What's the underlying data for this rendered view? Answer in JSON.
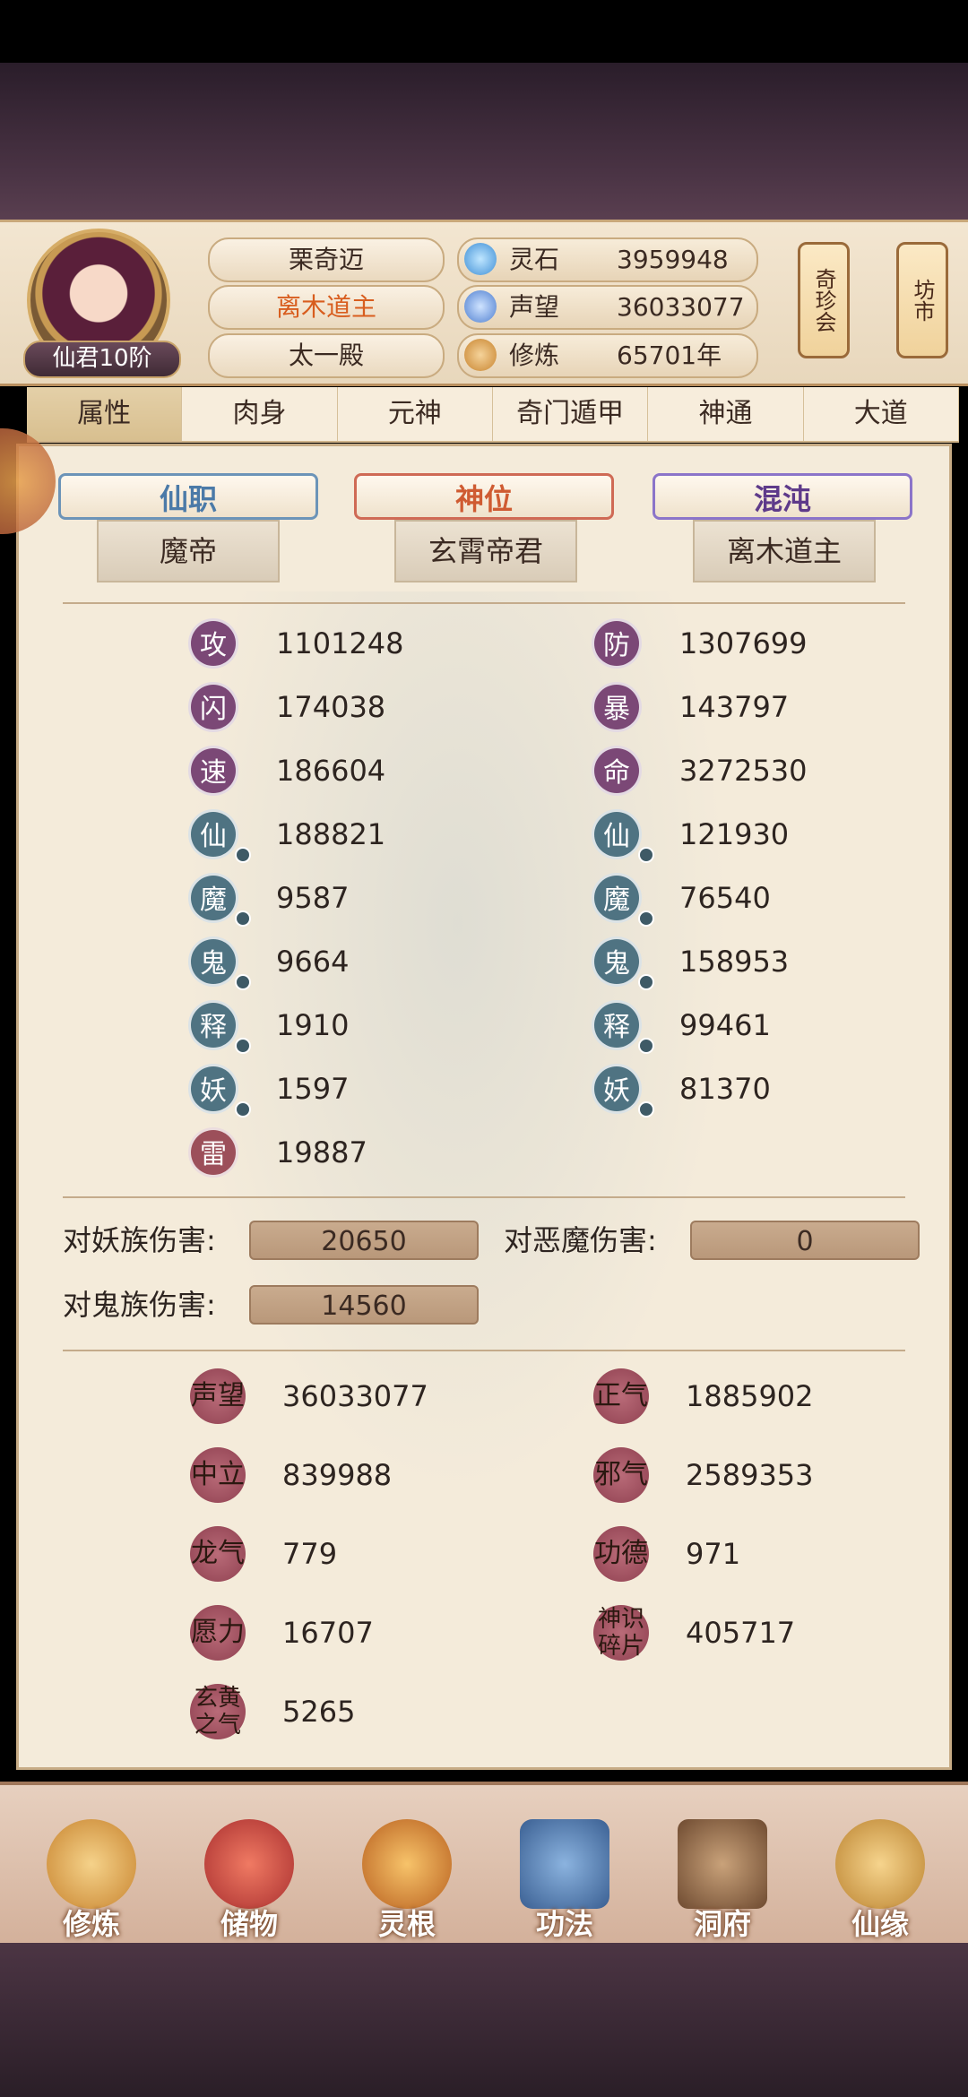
{
  "header": {
    "rank": "仙君10阶",
    "names": [
      "栗奇迈",
      "离木道主",
      "太一殿"
    ],
    "resources": [
      {
        "label": "灵石",
        "value": "3959948",
        "icon": "spirit-stone-icon",
        "color": "#4da6e8"
      },
      {
        "label": "声望",
        "value": "36033077",
        "icon": "reputation-icon",
        "color": "#4f8fd9"
      },
      {
        "label": "修炼",
        "value": "65701年",
        "icon": "meditation-icon",
        "color": "#d7953d"
      }
    ],
    "side_buttons": [
      {
        "label": "奇珍会"
      },
      {
        "label": "坊市"
      }
    ]
  },
  "tabs": [
    "属性",
    "肉身",
    "元神",
    "奇门遁甲",
    "神通",
    "大道"
  ],
  "titles": [
    {
      "banner": "仙职",
      "value": "魔帝"
    },
    {
      "banner": "神位",
      "value": "玄霄帝君"
    },
    {
      "banner": "混沌",
      "value": "离木道主"
    }
  ],
  "stats_left": [
    {
      "glyph": "攻",
      "value": "1101248",
      "color": "purple"
    },
    {
      "glyph": "闪",
      "value": "174038",
      "color": "purple"
    },
    {
      "glyph": "速",
      "value": "186604",
      "color": "purple"
    },
    {
      "glyph": "仙",
      "value": "188821",
      "color": "teal"
    },
    {
      "glyph": "魔",
      "value": "9587",
      "color": "teal"
    },
    {
      "glyph": "鬼",
      "value": "9664",
      "color": "teal"
    },
    {
      "glyph": "释",
      "value": "1910",
      "color": "teal"
    },
    {
      "glyph": "妖",
      "value": "1597",
      "color": "teal"
    },
    {
      "glyph": "雷",
      "value": "19887",
      "color": "red"
    }
  ],
  "stats_right": [
    {
      "glyph": "防",
      "value": "1307699",
      "color": "purple"
    },
    {
      "glyph": "暴",
      "value": "143797",
      "color": "purple"
    },
    {
      "glyph": "命",
      "value": "3272530",
      "color": "purple"
    },
    {
      "glyph": "仙",
      "value": "121930",
      "color": "teal"
    },
    {
      "glyph": "魔",
      "value": "76540",
      "color": "teal"
    },
    {
      "glyph": "鬼",
      "value": "158953",
      "color": "teal"
    },
    {
      "glyph": "释",
      "value": "99461",
      "color": "teal"
    },
    {
      "glyph": "妖",
      "value": "81370",
      "color": "teal"
    }
  ],
  "damage": [
    {
      "label": "对妖族伤害:",
      "value": "20650"
    },
    {
      "label": "对恶魔伤害:",
      "value": "0"
    },
    {
      "label": "对鬼族伤害:",
      "value": "14560"
    }
  ],
  "misc": [
    {
      "label": "声望",
      "value": "36033077"
    },
    {
      "label": "正气",
      "value": "1885902"
    },
    {
      "label": "中立",
      "value": "839988"
    },
    {
      "label": "邪气",
      "value": "2589353"
    },
    {
      "label": "龙气",
      "value": "779"
    },
    {
      "label": "功德",
      "value": "971"
    },
    {
      "label": "愿力",
      "value": "16707"
    },
    {
      "label": "神识碎片",
      "value": "405717"
    },
    {
      "label": "玄黄之气",
      "value": "5265"
    }
  ],
  "nav": [
    {
      "label": "修炼",
      "icon": "cultivate-icon",
      "color": "#d9a441"
    },
    {
      "label": "储物",
      "icon": "storage-bag-icon",
      "color": "#c94b47"
    },
    {
      "label": "灵根",
      "icon": "spirit-root-icon",
      "color": "#d88a2f"
    },
    {
      "label": "功法",
      "icon": "technique-book-icon",
      "color": "#4b76a8"
    },
    {
      "label": "洞府",
      "icon": "cave-abode-icon",
      "color": "#8a6a4a"
    },
    {
      "label": "仙缘",
      "icon": "gourd-icon",
      "color": "#d9a441"
    }
  ]
}
